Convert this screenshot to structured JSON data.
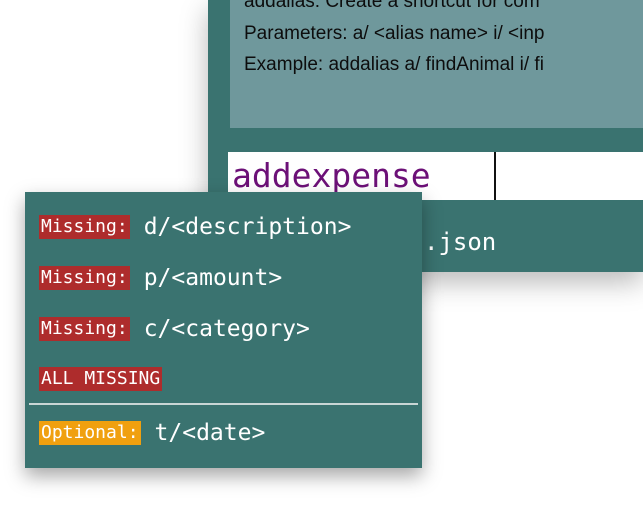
{
  "help": {
    "line1": "addalias: Create a shortcut for com",
    "line2": "Parameters: a/ <alias name>  i/ <inp",
    "line3": "Example: addalias a/ findAnimal i/ fi"
  },
  "command_box": {
    "value": "addexpense"
  },
  "result": {
    "text": ".json"
  },
  "autocomplete": {
    "items": [
      {
        "badge": "Missing:",
        "param": "d/<description>",
        "status": "missing"
      },
      {
        "badge": "Missing:",
        "param": "p/<amount>",
        "status": "missing"
      },
      {
        "badge": "Missing:",
        "param": "c/<category>",
        "status": "missing"
      }
    ],
    "all_missing": "ALL MISSING",
    "optional": {
      "badge": "Optional:",
      "param": "t/<date>"
    }
  },
  "colors": {
    "window_teal": "#3a7370",
    "help_panel": "#6f989c",
    "command_text": "#6c1077",
    "missing_badge": "#ae2c2c",
    "optional_badge": "#f0a00f"
  }
}
